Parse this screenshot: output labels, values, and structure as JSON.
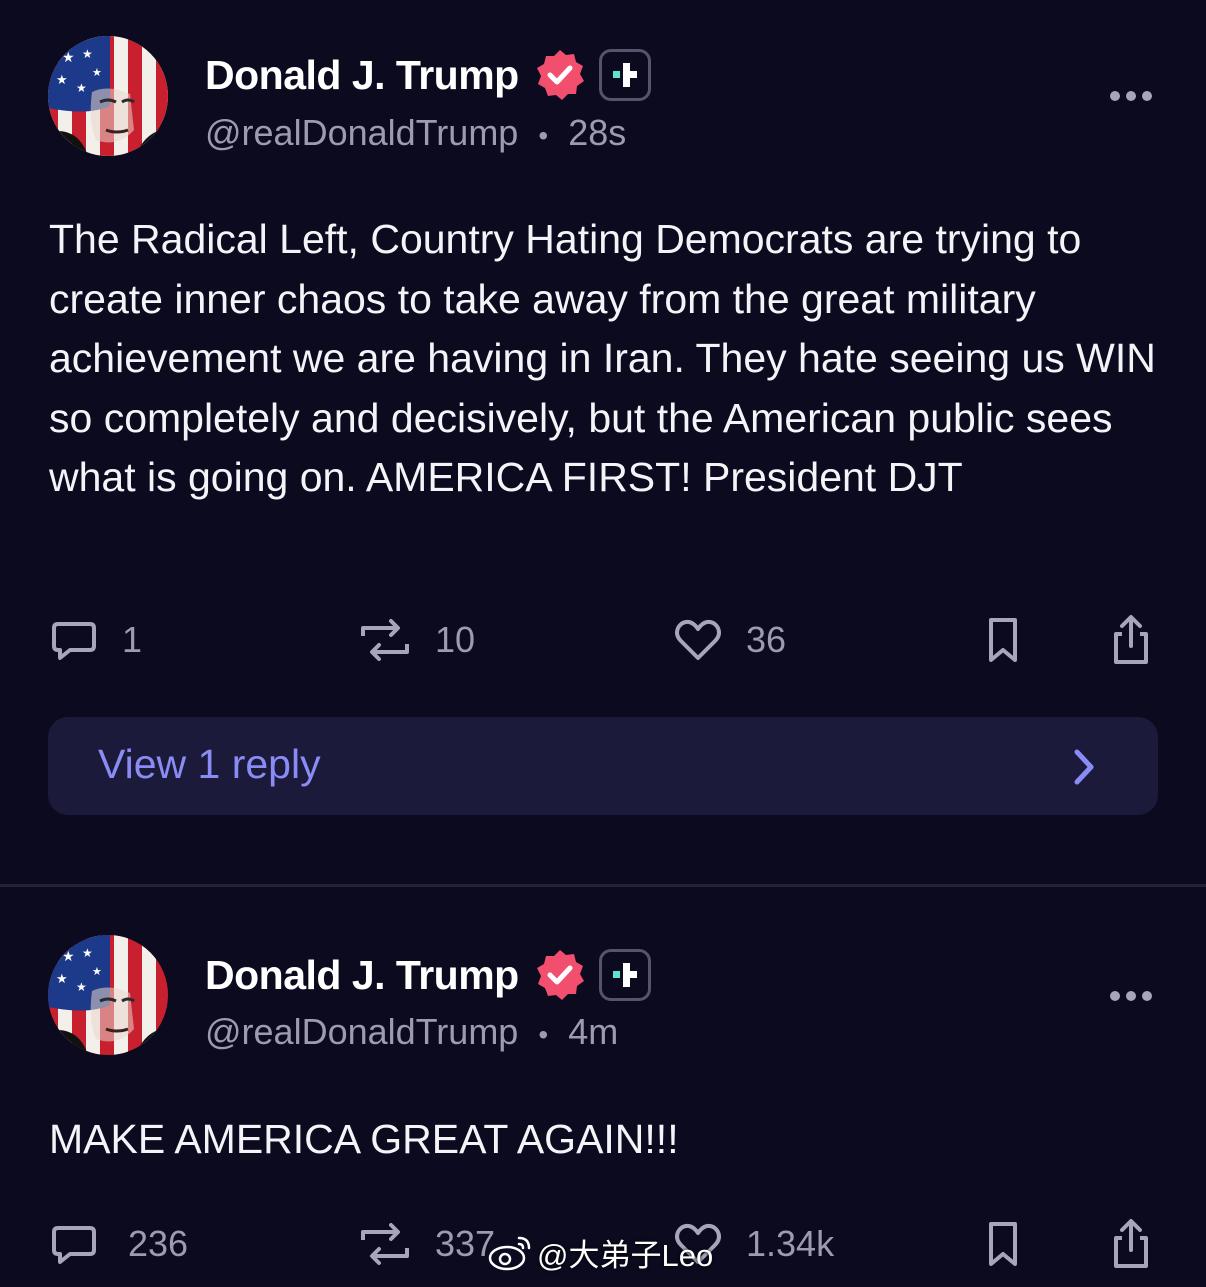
{
  "colors": {
    "background": "#0b0a1f",
    "verified_badge": "#f24f6f",
    "link_accent": "#8a8cf5",
    "muted_text": "#9c9bb0",
    "reply_panel": "#1b1a3a"
  },
  "posts": [
    {
      "author": {
        "display_name": "Donald J. Trump",
        "handle": "@realDonaldTrump",
        "separator": "•",
        "time": "28s",
        "verified_icon": "verified-badge-icon",
        "plus_icon": "truth-plus-icon",
        "avatar": "avatar-flag-portrait"
      },
      "text": "The Radical Left, Country Hating Democrats are trying to create inner chaos to take away from the great military achievement we are having in Iran. They hate seeing us WIN so completely and decisively, but the American public sees what is going on. AMERICA FIRST! President DJT",
      "actions": {
        "replies": "1",
        "reposts": "10",
        "likes": "36",
        "reply_icon": "comment-icon",
        "repost_icon": "repost-icon",
        "like_icon": "heart-icon",
        "bookmark_icon": "bookmark-icon",
        "share_icon": "share-icon"
      },
      "view_replies": {
        "label": "View 1 reply",
        "icon": "chevron-right-icon"
      }
    },
    {
      "author": {
        "display_name": "Donald J. Trump",
        "handle": "@realDonaldTrump",
        "separator": "•",
        "time": "4m",
        "verified_icon": "verified-badge-icon",
        "plus_icon": "truth-plus-icon",
        "avatar": "avatar-flag-portrait"
      },
      "text": "MAKE AMERICA GREAT AGAIN!!!",
      "actions": {
        "replies": "236",
        "reposts": "337",
        "likes": "1.34k",
        "reply_icon": "comment-icon",
        "repost_icon": "repost-icon",
        "like_icon": "heart-icon",
        "bookmark_icon": "bookmark-icon",
        "share_icon": "share-icon"
      }
    }
  ],
  "watermark": {
    "text": "@大弟子Leo",
    "icon": "weibo-logo-icon"
  }
}
